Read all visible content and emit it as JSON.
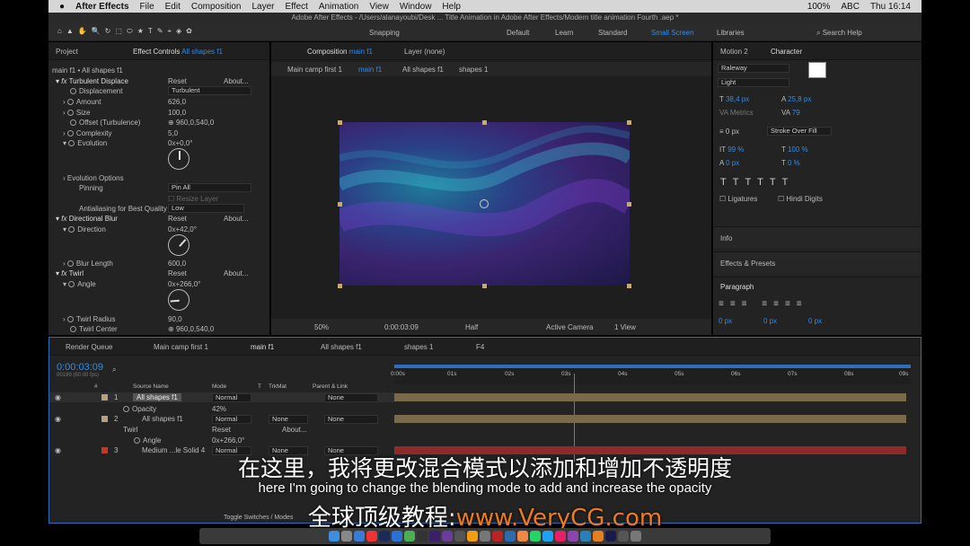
{
  "mac_menu": {
    "apple": "",
    "app": "After Effects",
    "items": [
      "File",
      "Edit",
      "Composition",
      "Layer",
      "Effect",
      "Animation",
      "View",
      "Window",
      "Help"
    ],
    "right": [
      "100%",
      "ABC",
      "Thu 16:14"
    ]
  },
  "window_title": "Adobe After Effects - /Users/alanayoubi/Desk ... Title Animation in Adobe After Effects/Modern title animation Fourth .aep *",
  "toolbar": {
    "snapping": "Snapping",
    "workspaces": [
      "Default",
      "Learn",
      "Standard",
      "Small Screen"
    ],
    "libraries": "Libraries",
    "search": "Search Help"
  },
  "left_tabs": {
    "project": "Project",
    "effect_controls": "Effect Controls",
    "layer": "All shapes f1"
  },
  "ec_path": "main f1 • All shapes f1",
  "effects": {
    "turb": {
      "name": "Turbulent Displace",
      "reset": "Reset",
      "about": "About...",
      "disp_label": "Displacement",
      "disp_val": "Turbulent",
      "amount_label": "Amount",
      "amount": "626,0",
      "size_label": "Size",
      "size": "100,0",
      "offset_label": "Offset (Turbulence)",
      "offset": "960,0,540,0",
      "complexity_label": "Complexity",
      "complexity": "5,0",
      "evolution_label": "Evolution",
      "evolution": "0x+0,0°",
      "evo_opt": "Evolution Options",
      "pinning_label": "Pinning",
      "pinning": "Pin All",
      "resize": "Resize Layer",
      "aa_label": "Antialiasing for Best Quality",
      "aa": "Low"
    },
    "blur": {
      "name": "Directional Blur",
      "reset": "Reset",
      "about": "About...",
      "dir_label": "Direction",
      "dir": "0x+42,0°",
      "len_label": "Blur Length",
      "len": "600,0"
    },
    "twirl": {
      "name": "Twirl",
      "reset": "Reset",
      "about": "About...",
      "angle_label": "Angle",
      "angle": "0x+266,0°",
      "radius_label": "Twirl Radius",
      "radius": "90,0",
      "center_label": "Twirl Center",
      "center": "960,0,540,0"
    }
  },
  "comp": {
    "tab": "Composition",
    "tab_name": "main f1",
    "layer_tab": "Layer (none)",
    "crumbs": [
      "Main camp first 1",
      "main f1",
      "All shapes f1",
      "shapes 1"
    ],
    "zoom": "50%",
    "time": "0:00:03:09",
    "res": "Half",
    "camera": "Active Camera",
    "view": "1 View"
  },
  "right": {
    "tabs": [
      "Motion 2",
      "Character"
    ],
    "font": "Raleway",
    "style": "Light",
    "size": "38,4 px",
    "leading": "25,8 px",
    "tracking": "79",
    "kern": "Metrics",
    "stroke": "0 px",
    "stroke_mode": "Stroke Over Fill",
    "vscale": "99 %",
    "hscale": "100 %",
    "baseline": "0 px",
    "tsume": "0 %",
    "ligatures": "Ligatures",
    "hindi": "Hindi Digits",
    "info": "Info",
    "effects_presets": "Effects & Presets",
    "paragraph": "Paragraph",
    "indent": [
      "0 px",
      "0 px",
      "0 px"
    ]
  },
  "timeline": {
    "tabs": [
      "Render Queue",
      "Main camp first 1",
      "main f1",
      "All shapes f1",
      "shapes 1",
      "F4"
    ],
    "time": "0:00:03:09",
    "fps": "00189 (60.00 fps)",
    "cols": [
      "#",
      "Source Name",
      "Mode",
      "T",
      "TrkMat",
      "Parent & Link"
    ],
    "rulers": [
      "0:00s",
      "01s",
      "02s",
      "03s",
      "04s",
      "05s",
      "06s",
      "07s",
      "08s",
      "09s"
    ],
    "layers": [
      {
        "num": "1",
        "name": "All shapes f1",
        "mode": "Normal",
        "trk": "",
        "parent": "None",
        "color": "#b8a07a"
      },
      {
        "num": "2",
        "name": "All shapes f1",
        "mode": "Normal",
        "trk": "None",
        "parent": "None",
        "color": "#b8a07a"
      },
      {
        "num": "3",
        "name": "Medium ...le Solid 4",
        "mode": "Normal",
        "trk": "None",
        "parent": "None",
        "color": "#c0392b"
      }
    ],
    "opacity_label": "Opacity",
    "opacity": "42%",
    "twirl_label": "Twirl",
    "twirl_reset": "Reset",
    "twirl_about": "About...",
    "angle_label": "Angle",
    "angle": "0x+266,0°",
    "toggle": "Toggle Switches / Modes"
  },
  "subtitles": {
    "cn": "在这里，我将更改混合模式以添加和增加不透明度",
    "en": "here I'm going to change the blending mode to add and increase the opacity",
    "brand": "全球顶级教程:",
    "url": "www.VeryCG.com"
  }
}
